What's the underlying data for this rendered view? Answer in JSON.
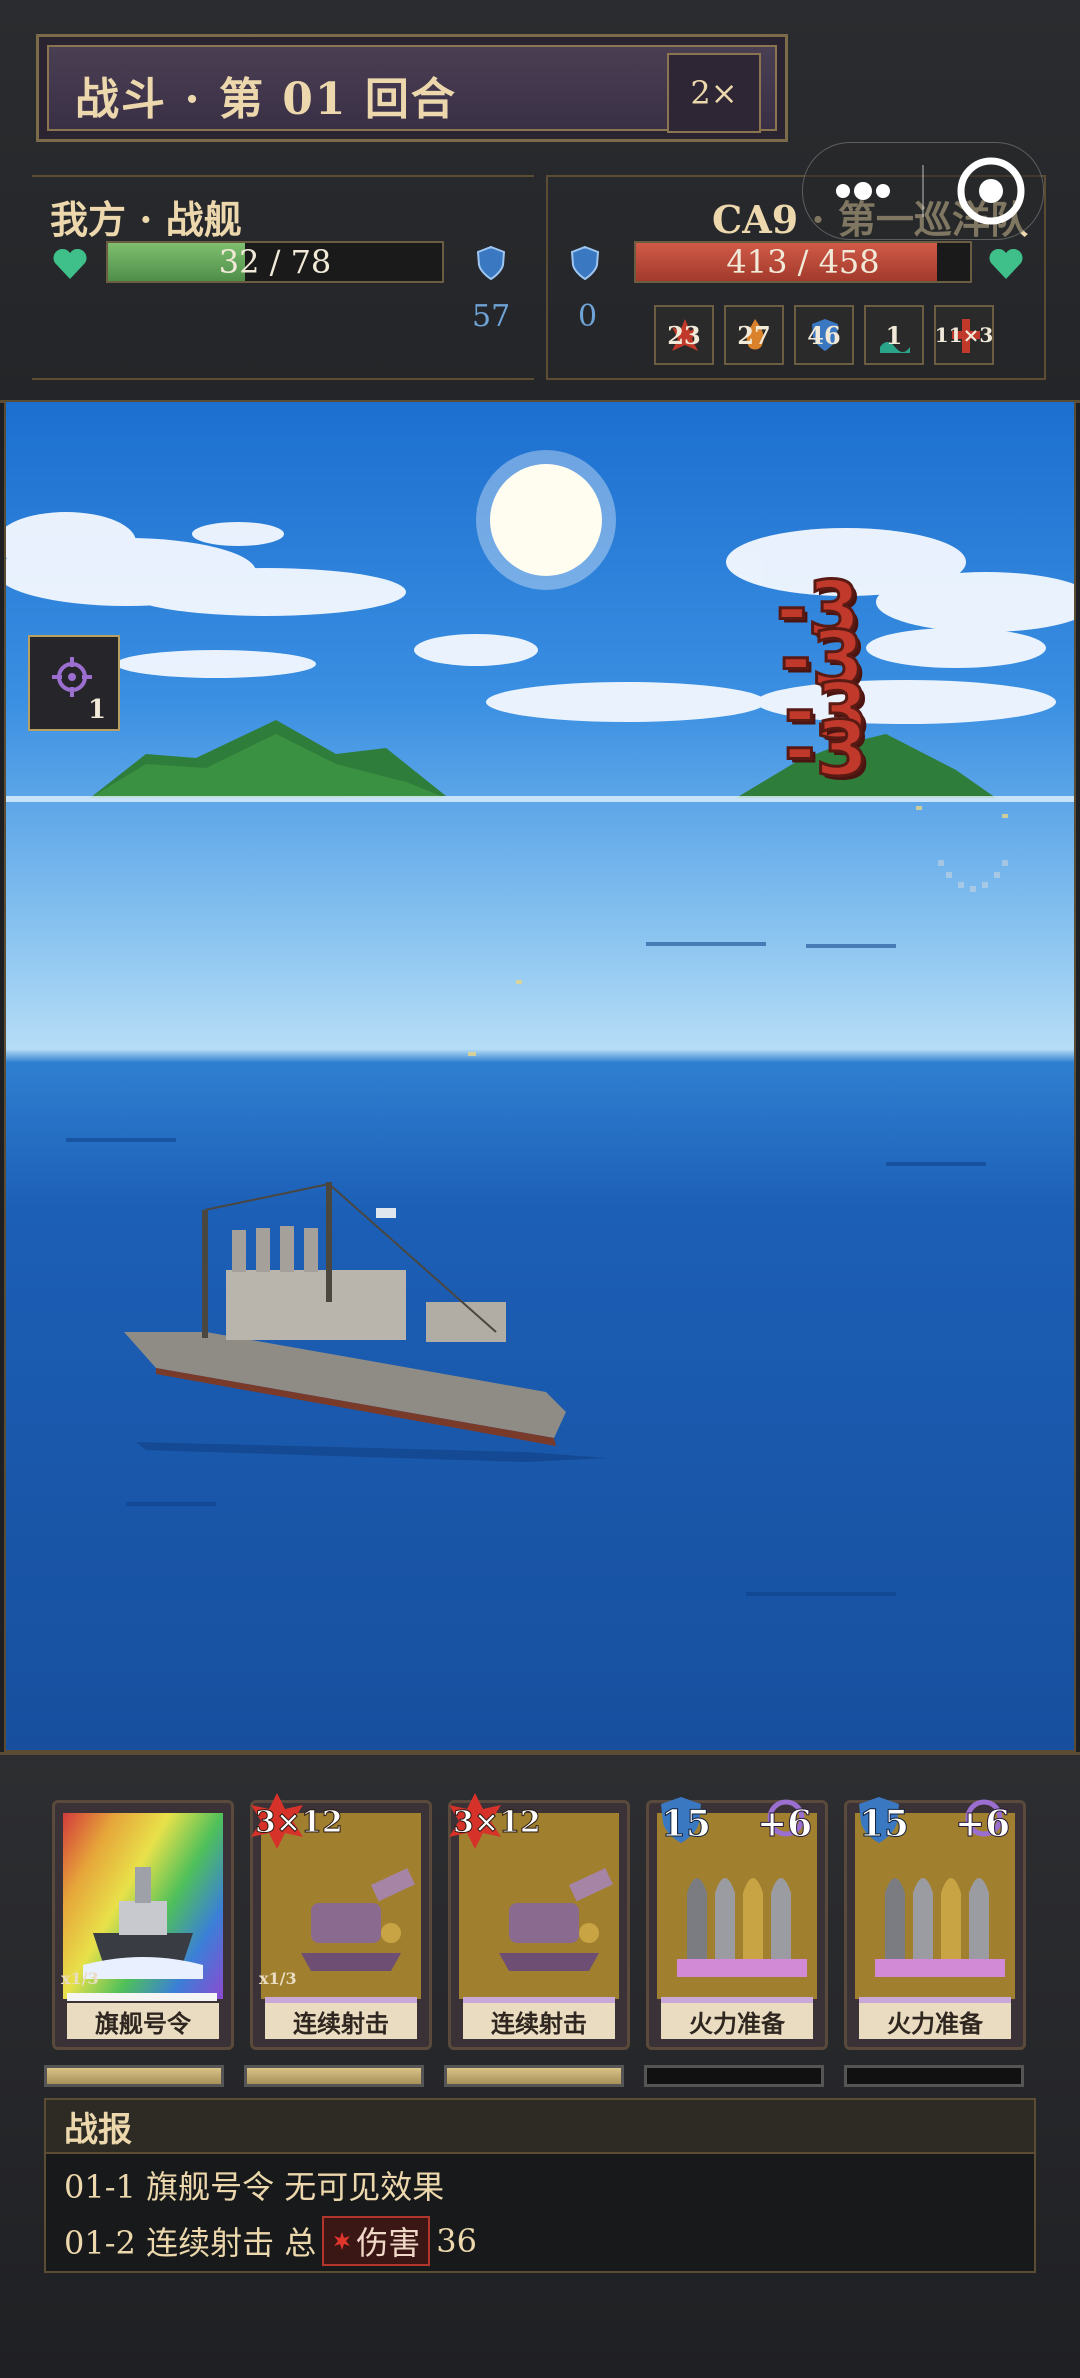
{
  "header": {
    "title": "战斗 · 第 01 回合",
    "speed": "2×"
  },
  "player": {
    "name": "我方 · 战舰",
    "hp_text": "32 / 78",
    "hp_fraction": 0.41,
    "shield": "57"
  },
  "enemy": {
    "name": "CA9 · 第一巡洋队",
    "hp_text": "413 / 458",
    "hp_fraction": 0.9,
    "shield": "0",
    "statuses": [
      {
        "icon": "red-burst-icon",
        "value": "23"
      },
      {
        "icon": "orange-burst-icon",
        "value": "27"
      },
      {
        "icon": "blue-shield-icon",
        "value": "46"
      },
      {
        "icon": "teal-wave-icon",
        "value": "1"
      },
      {
        "icon": "red-cross-icon",
        "value": "11×3"
      }
    ]
  },
  "scene": {
    "skill_slot_count": "1",
    "damage_numbers": [
      "-3",
      "-3",
      "-3",
      "-3"
    ]
  },
  "cards": [
    {
      "label": "旗舰号令",
      "badge": "",
      "badge2": "",
      "uses": "x1/3",
      "art": "flagship-rainbow-art",
      "energy": 1.0
    },
    {
      "label": "连续射击",
      "badge": "3×12",
      "badge2": "",
      "uses": "x1/3",
      "art": "cannon-art",
      "energy": 1.0
    },
    {
      "label": "连续射击",
      "badge": "3×12",
      "badge2": "",
      "uses": "",
      "art": "cannon-art",
      "energy": 1.0
    },
    {
      "label": "火力准备",
      "badge": "15",
      "badge2": "+6",
      "uses": "",
      "art": "shells-art",
      "energy": 0.0
    },
    {
      "label": "火力准备",
      "badge": "15",
      "badge2": "+6",
      "uses": "",
      "art": "shells-art",
      "energy": 0.0
    }
  ],
  "report": {
    "title": "战报",
    "lines": [
      {
        "text": "01-1 旗舰号令 无可见效果"
      },
      {
        "prefix": "01-2 连续射击 总",
        "tag": "伤害",
        "value": "36"
      }
    ]
  },
  "colors": {
    "player_hp": "#6aa86a",
    "enemy_hp": "#c0493a",
    "accent_gold": "#ecd8ac",
    "shield_blue": "#4f8fd4"
  }
}
